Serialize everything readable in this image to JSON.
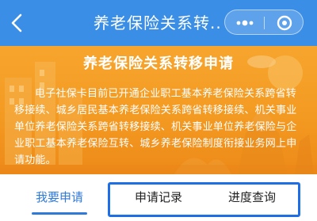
{
  "header": {
    "title": "养老保险关系转...",
    "background": "#3a8ee6",
    "back_icon": "chevron-left-icon",
    "more_icon": "more-dots-icon",
    "close_icon": "target-close-icon"
  },
  "banner": {
    "title": "养老保险关系转移申请",
    "description": "电子社保卡目前已开通企业职工基本养老保险关系跨省转移接续、城乡居民基本养老保险关系跨省转移接续、机关事业单位养老保险关系跨省转移接续、机关事业单位养老保险与企业职工基本养老保险互转、城乡养老保险制度衔接业务网上申请功能。",
    "background": "#f39a22"
  },
  "tabs": {
    "items": [
      {
        "label": "我要申请",
        "active": true
      },
      {
        "label": "申请记录",
        "active": false
      },
      {
        "label": "进度查询",
        "active": false
      }
    ],
    "active_color": "#2f7ad8",
    "highlight_color": "#1e6fe5"
  }
}
